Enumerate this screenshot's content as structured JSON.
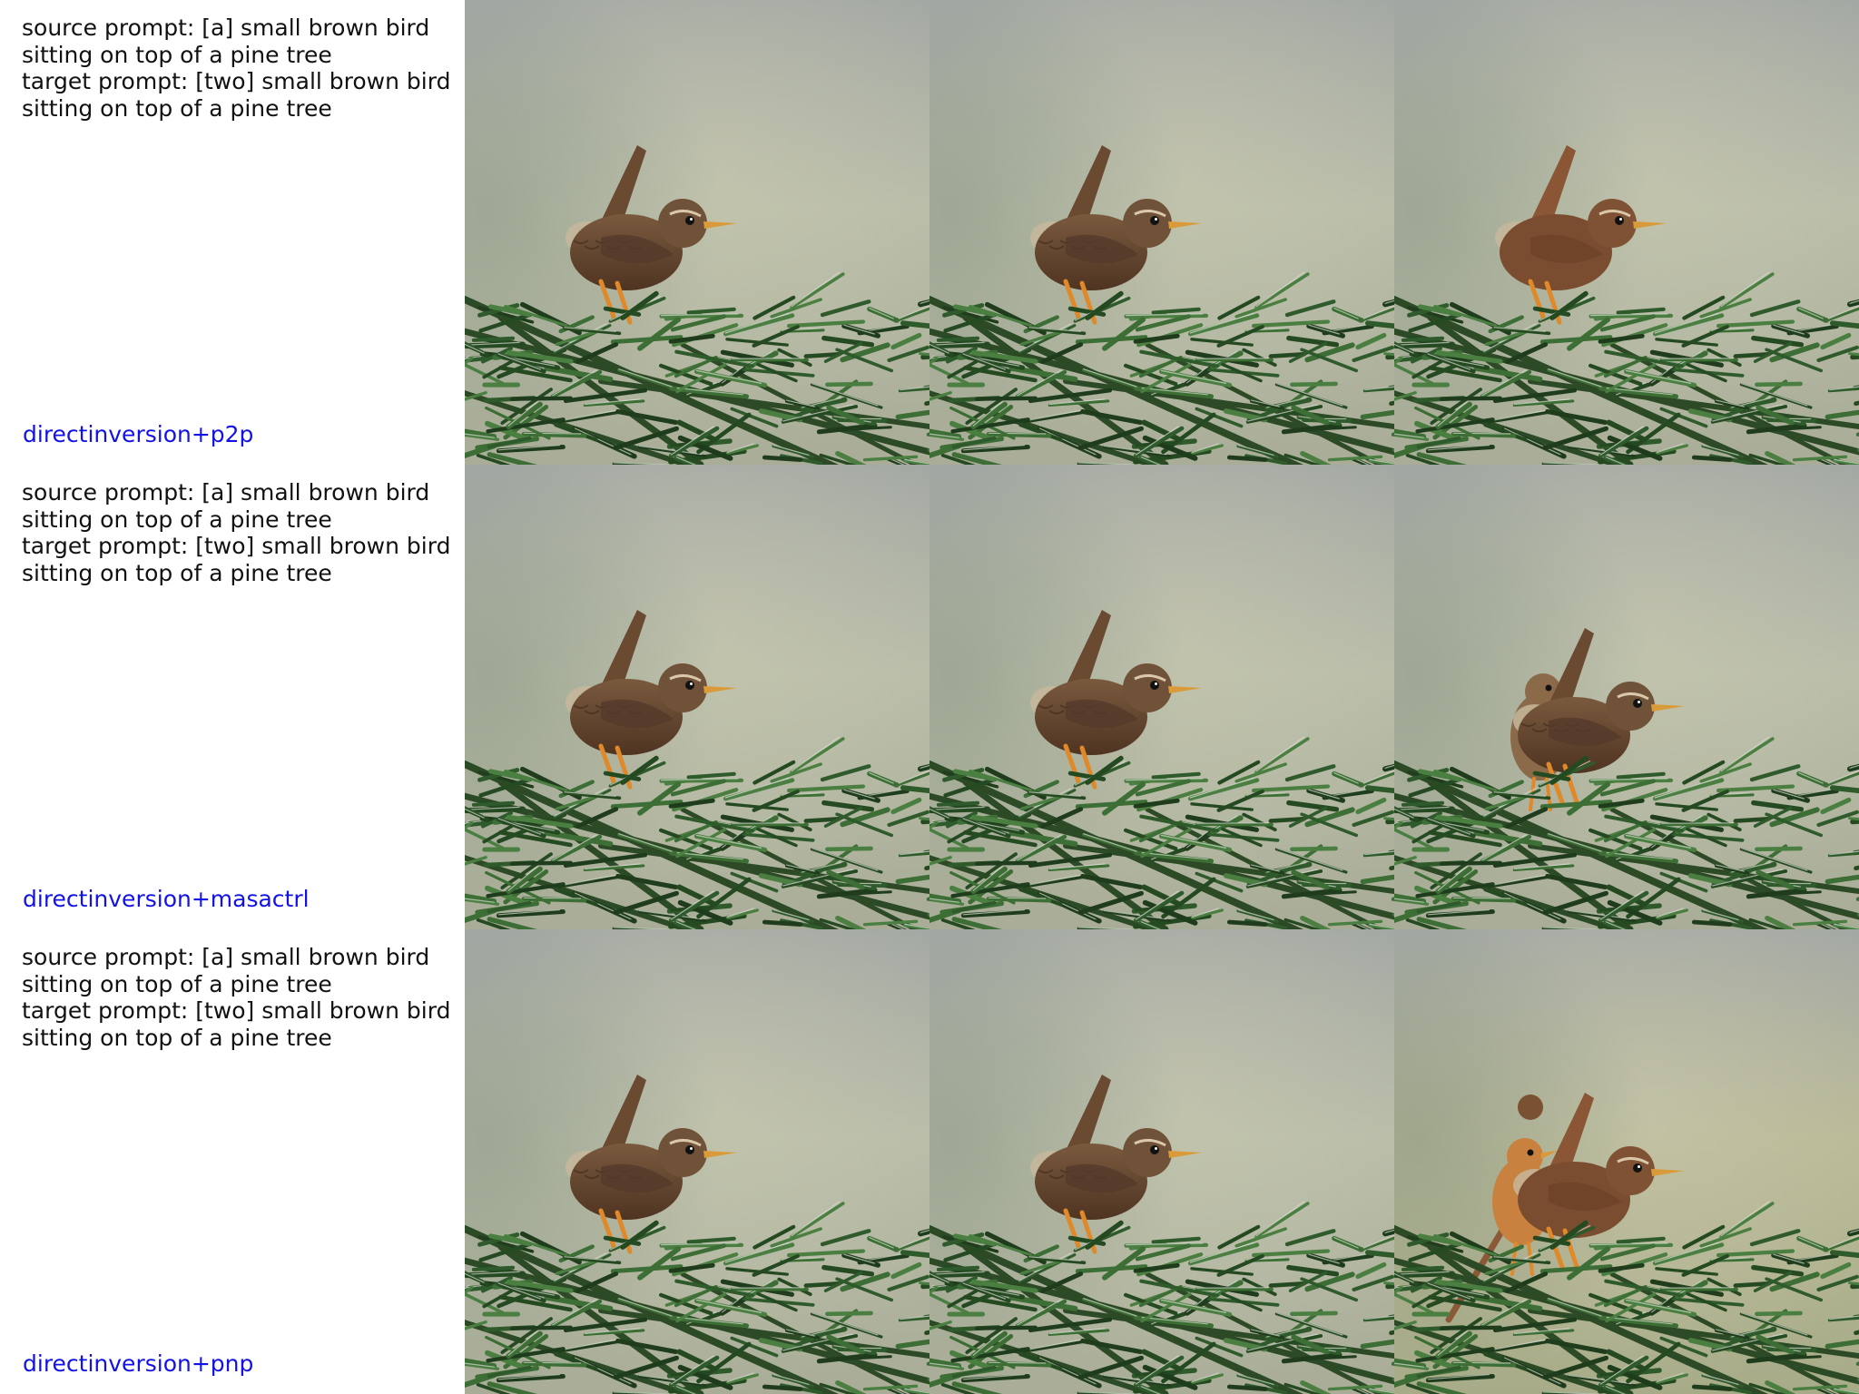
{
  "rows": [
    {
      "source_prompt_line1": "source prompt: [a] small brown bird",
      "source_prompt_line2": "sitting on top of a pine tree",
      "target_prompt_line1": "target prompt: [two] small brown bird",
      "target_prompt_line2": "sitting on top of a pine tree",
      "method": "directinversion+p2p",
      "images": [
        {
          "content": "single-wren-on-pine"
        },
        {
          "content": "single-wren-on-pine"
        },
        {
          "content": "single-wren-smooth-on-pine"
        }
      ]
    },
    {
      "source_prompt_line1": "source prompt: [a] small brown bird",
      "source_prompt_line2": "sitting on top of a pine tree",
      "target_prompt_line1": "target prompt: [two] small brown bird",
      "target_prompt_line2": "sitting on top of a pine tree",
      "method": "directinversion+masactrl",
      "images": [
        {
          "content": "single-wren-on-pine"
        },
        {
          "content": "single-wren-on-pine"
        },
        {
          "content": "two-wrens-on-pine"
        }
      ]
    },
    {
      "source_prompt_line1": "source prompt: [a] small brown bird",
      "source_prompt_line2": "sitting on top of a pine tree",
      "target_prompt_line1": "target prompt: [two] small brown bird",
      "target_prompt_line2": "sitting on top of a pine tree",
      "method": "directinversion+pnp",
      "images": [
        {
          "content": "single-wren-on-pine"
        },
        {
          "content": "single-wren-on-pine"
        },
        {
          "content": "two-birds-orange-and-wren-on-pine"
        }
      ]
    }
  ],
  "colors": {
    "method_label": "#1212e8",
    "prompt_text": "#111111",
    "wren_brown": "#6b4a32",
    "needle_green": "#2f5a2c"
  }
}
